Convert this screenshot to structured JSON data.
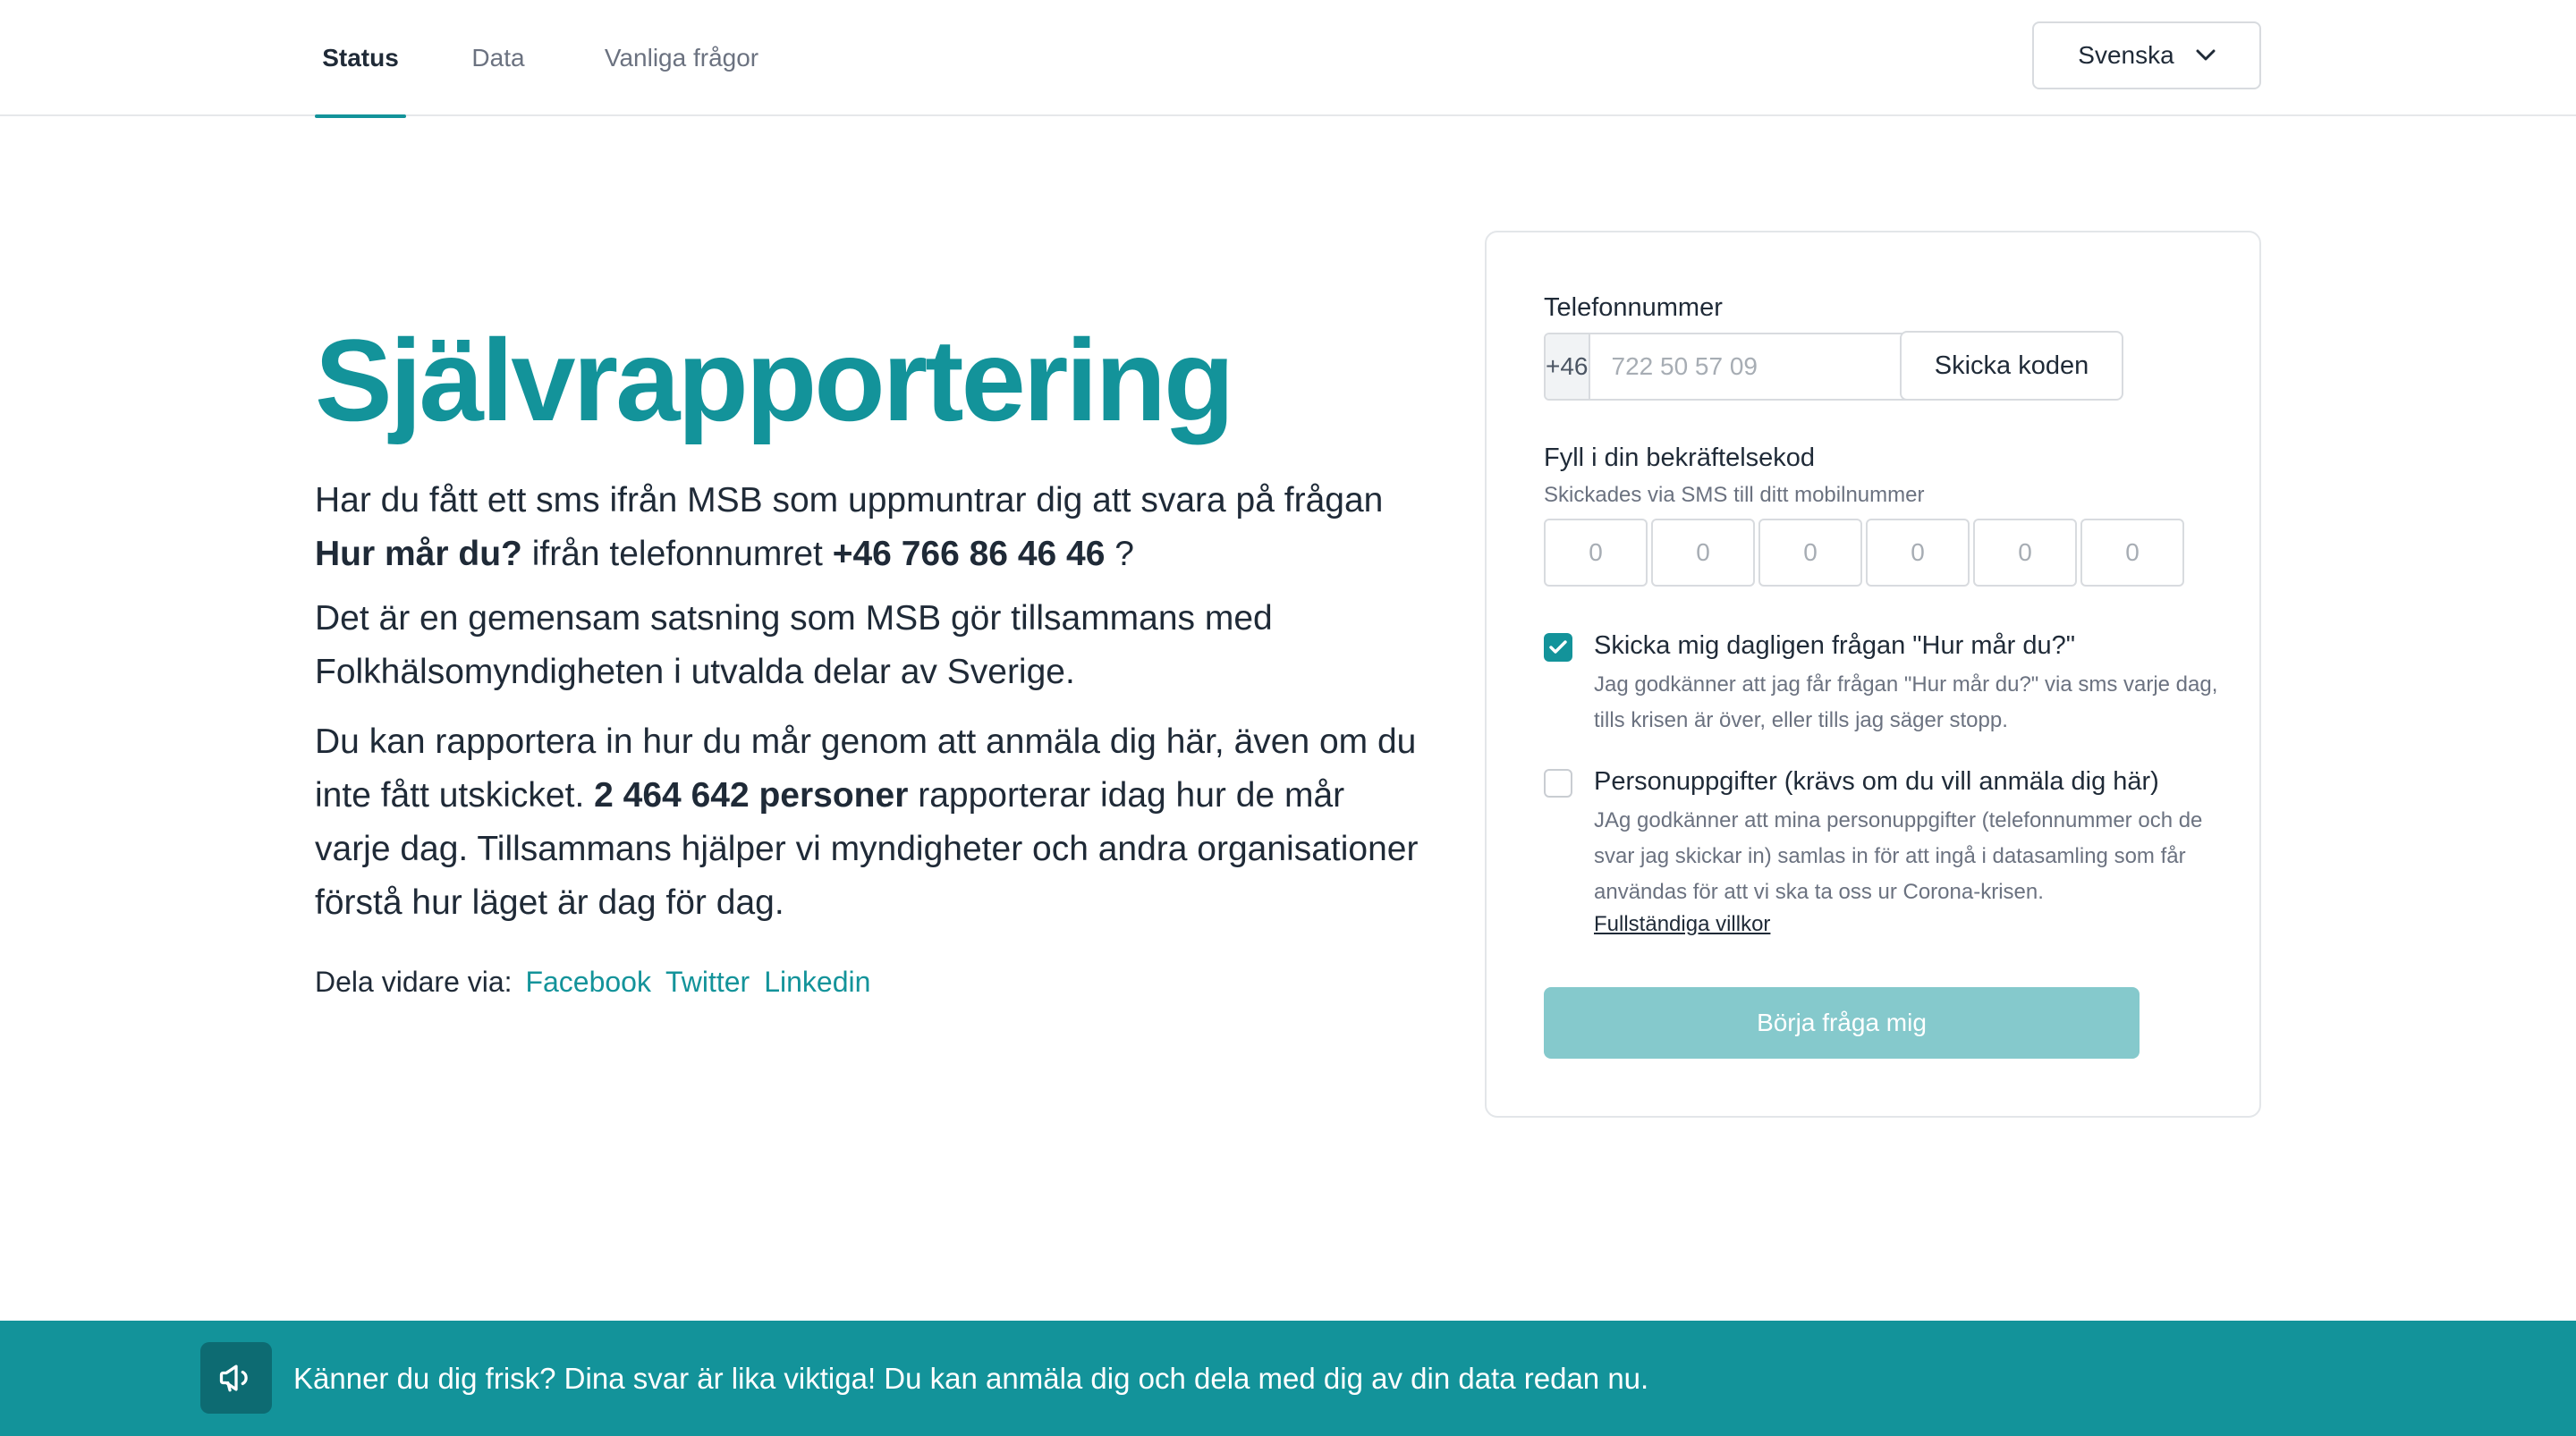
{
  "nav": {
    "tabs": [
      {
        "label": "Status",
        "active": true
      },
      {
        "label": "Data",
        "active": false
      },
      {
        "label": "Vanliga frågor",
        "active": false
      }
    ],
    "language": "Svenska"
  },
  "hero": {
    "title": "Självrapportering",
    "p1": {
      "a": "Har du fått ett sms ifrån MSB som uppmuntrar dig att svara på frågan ",
      "bold1": "Hur mår du?",
      "b": " ifrån telefonnumret ",
      "bold2": "+46 766 86 46 46",
      "c": " ?"
    },
    "p2": "Det är en gemensam satsning som MSB gör tillsammans med Folkhälsomyndigheten i utvalda delar av Sverige.",
    "p3": {
      "a": "Du kan rapportera in hur du mår genom att anmäla dig här, även om du inte fått utskicket. ",
      "bold": "2 464 642 personer",
      "b": " rapporterar idag hur de mår varje dag. Tillsammans hjälper vi myndigheter och andra organisationer förstå hur läget är dag för dag."
    },
    "share": {
      "label": "Dela vidare via:",
      "links": [
        "Facebook",
        "Twitter",
        "Linkedin"
      ]
    }
  },
  "form": {
    "phone_label": "Telefonnummer",
    "prefix": "+46",
    "phone_placeholder": "722 50 57 09",
    "send_code": "Skicka koden",
    "code_label": "Fyll i din bekräftelsekod",
    "code_sublabel": "Skickades via SMS till ditt mobilnummer",
    "code_placeholders": [
      "0",
      "0",
      "0",
      "0",
      "0",
      "0"
    ],
    "daily": {
      "title": "Skicka mig dagligen frågan \"Hur mår du?\"",
      "desc": "Jag godkänner att jag får frågan \"Hur mår du?\" via sms varje dag, tills krisen är över, eller tills jag säger stopp.",
      "checked": true
    },
    "personal": {
      "title": "Personuppgifter (krävs om du vill anmäla dig här)",
      "desc": "JAg godkänner att mina personuppgifter (telefonnummer och de svar jag skickar in) samlas in för att ingå i datasamling som får användas för att vi ska ta oss ur Corona-krisen.",
      "checked": false
    },
    "terms_link": "Fullständiga villkor",
    "submit": "Börja fråga mig"
  },
  "banner": {
    "icon": "megaphone-icon",
    "text": "Känner du dig frisk? Dina svar är lika viktiga! Du kan anmäla dig och dela med dig av din data redan nu."
  },
  "colors": {
    "accent": "#13939a",
    "banner_icon_bg": "#0d6b72",
    "submit_disabled": "#85c9cc"
  }
}
